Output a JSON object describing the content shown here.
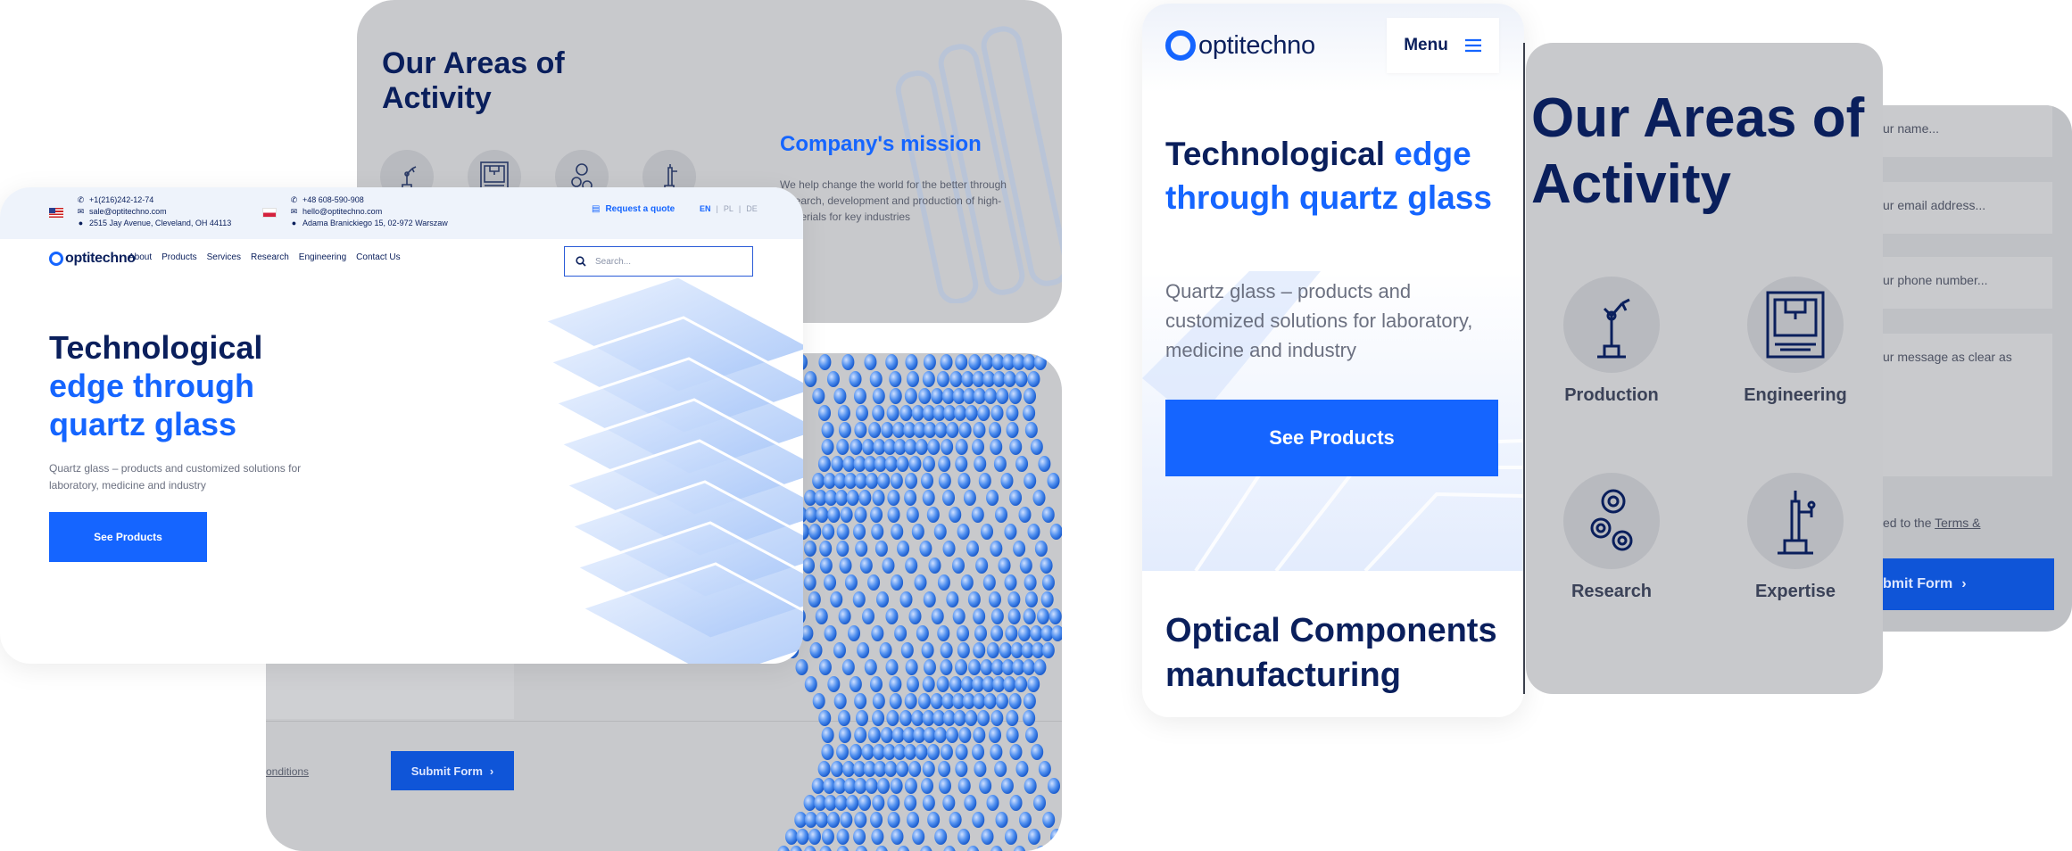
{
  "colors": {
    "brand_blue": "#1565ff",
    "navy": "#0a1f5c",
    "overlay_grey": "#c8c9cc"
  },
  "areas_desktop": {
    "title_line1": "Our Areas of",
    "title_line2": "Activity",
    "mission_title": "Company's mission",
    "mission_text": "We help change the world for the better through research, development and production of high- materials for key industries",
    "icons": [
      "robot-arm-icon",
      "3d-printer-icon",
      "gears-icon",
      "microscope-icon"
    ]
  },
  "form_desktop": {
    "terms_link": "onditions",
    "submit_label": "Submit Form",
    "submit_icon": "chevron-right-icon"
  },
  "desktop": {
    "contacts_us": {
      "phone": "+1(216)242-12-74",
      "email": "sale@optitechno.com",
      "address": "2515 Jay Avenue, Cleveland, OH 44113"
    },
    "contacts_pl": {
      "phone": "+48 608-590-908",
      "email": "hello@optitechno.com",
      "address": "Adama Branickiego 15, 02-972 Warszaw"
    },
    "request_quote": "Request a quote",
    "langs": [
      "EN",
      "PL",
      "DE"
    ],
    "lang_sep": "|",
    "logo": "optitechno",
    "nav": [
      "About",
      "Products",
      "Services",
      "Research",
      "Engineering",
      "Contact Us"
    ],
    "search_placeholder": "Search...",
    "hero_line1": "Technological",
    "hero_line2": "edge through",
    "hero_line3": "quartz glass",
    "hero_sub": "Quartz glass – products and customized solutions for laboratory, medicine and industry",
    "cta": "See Products"
  },
  "mobile": {
    "logo": "optitechno",
    "menu": "Menu",
    "hero_plain": "Technological ",
    "hero_accent": "edge through quartz glass",
    "hero_sub": "Quartz glass – products and customized solutions for laboratory, medicine and industry",
    "cta": "See Products",
    "section_title": "Optical Components manufacturing"
  },
  "areas_mobile": {
    "title": "Our Areas of Activity",
    "items": [
      {
        "label": "Production",
        "icon": "robot-arm-icon"
      },
      {
        "label": "Engineering",
        "icon": "3d-printer-icon"
      },
      {
        "label": "Research",
        "icon": "gears-icon"
      },
      {
        "label": "Expertise",
        "icon": "microscope-icon"
      }
    ]
  },
  "form_mobile": {
    "name_placeholder": "ur name...",
    "email_placeholder": "ur email address...",
    "phone_placeholder": "ur phone number...",
    "message_placeholder": "ur message as clear as",
    "terms_prefix": "ed to the ",
    "terms_link": "Terms &",
    "submit_label": "bmit Form",
    "submit_icon": "chevron-right-icon"
  }
}
